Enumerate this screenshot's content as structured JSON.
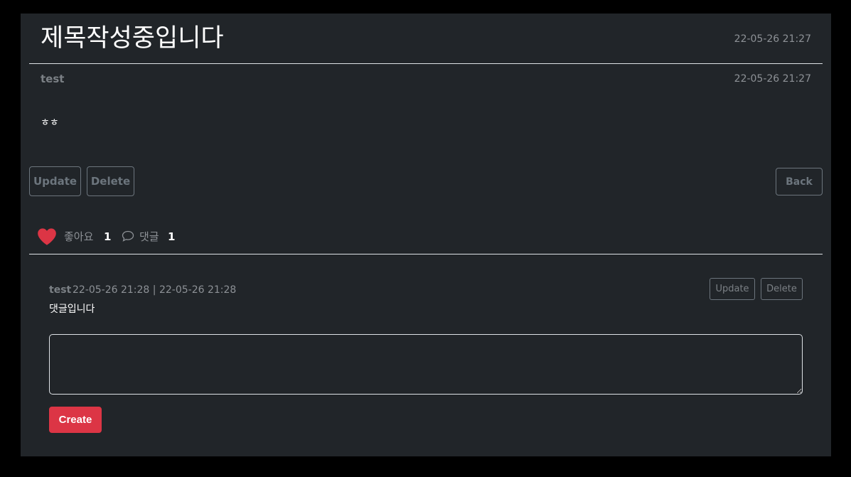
{
  "post": {
    "title": "제목작성중입니다",
    "created": "22-05-26 21:27",
    "author": "test",
    "modified": "22-05-26 21:27",
    "content": "ㅎㅎ",
    "update_label": "Update",
    "delete_label": "Delete",
    "back_label": "Back"
  },
  "stats": {
    "like_label": "좋아요",
    "like_count": "1",
    "comment_label": "댓글",
    "comment_count": "1",
    "heart_color": "#dc3545"
  },
  "comments": [
    {
      "author": "test",
      "meta": "22-05-26 21:28 | 22-05-26 21:28",
      "text": "댓글입니다",
      "update_label": "Update",
      "delete_label": "Delete"
    }
  ],
  "reply": {
    "value": "",
    "create_label": "Create"
  },
  "colors": {
    "background": "#000000",
    "panel": "#212529",
    "accent": "#dc3545",
    "muted": "#6c757d"
  }
}
